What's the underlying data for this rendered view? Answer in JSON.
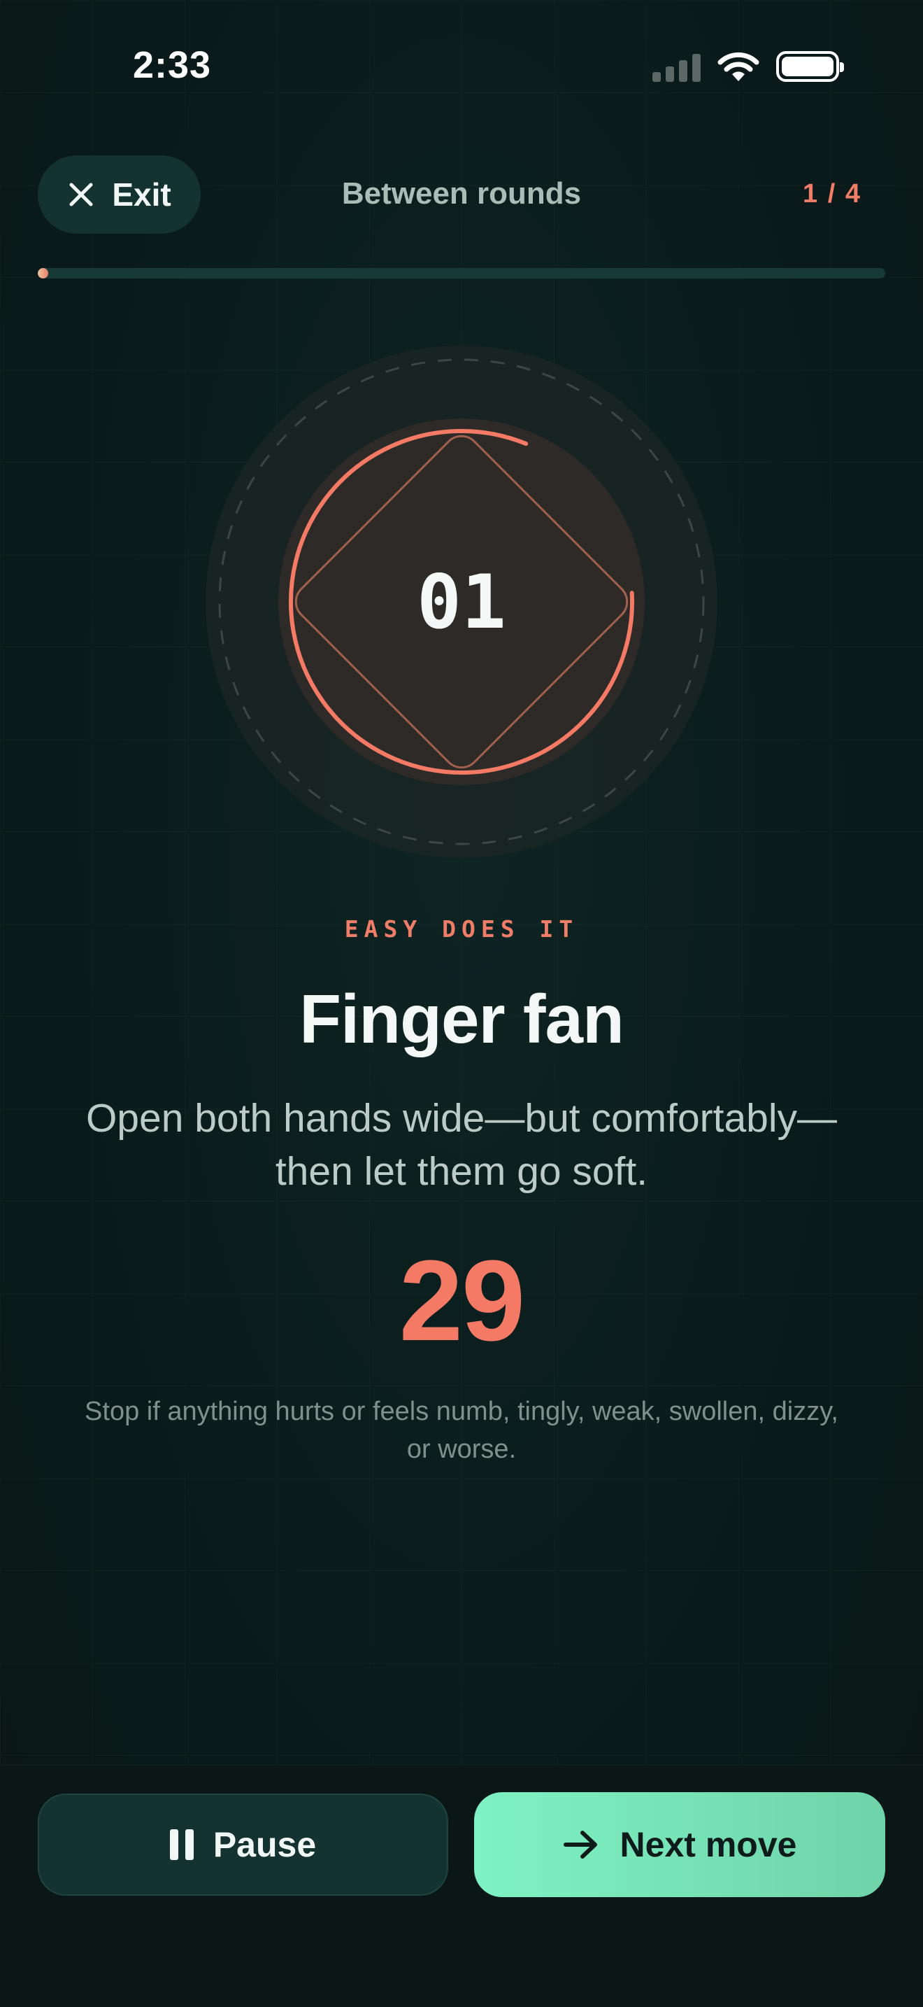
{
  "status_bar": {
    "time": "2:33"
  },
  "header": {
    "exit_label": "Exit",
    "title": "Between rounds",
    "round_counter": "1 / 4",
    "progress": 0.01
  },
  "dial": {
    "number": "01",
    "arc_progress": 0.82
  },
  "exercise": {
    "eyebrow": "EASY DOES IT",
    "title": "Finger fan",
    "instructions": "Open both hands wide—but comfortably—then let them go soft.",
    "countdown": "29",
    "safety_note": "Stop if anything hurts or feels numb, tingly, weak, swollen, dizzy, or worse."
  },
  "actions": {
    "pause_label": "Pause",
    "next_label": "Next move"
  },
  "colors": {
    "accent_coral": "#f07d68",
    "accent_mint": "#7ef2c4",
    "background": "#0a1b1b"
  }
}
